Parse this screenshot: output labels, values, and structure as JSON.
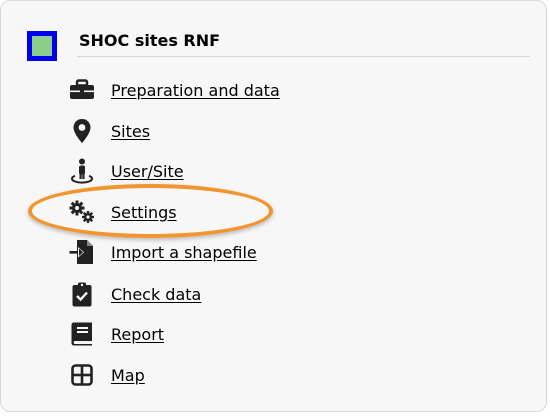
{
  "header": {
    "title": "SHOC sites RNF",
    "logo_colors": {
      "border": "#0000ee",
      "fill": "#8ccf8c"
    }
  },
  "menu": {
    "items": [
      {
        "label": "Preparation and data",
        "icon": "toolbox-icon"
      },
      {
        "label": "Sites",
        "icon": "map-marker-icon"
      },
      {
        "label": "User/Site",
        "icon": "user-location-icon"
      },
      {
        "label": "Settings",
        "icon": "gears-icon"
      },
      {
        "label": "Import a shapefile",
        "icon": "file-import-icon"
      },
      {
        "label": "Check data",
        "icon": "clipboard-check-icon"
      },
      {
        "label": "Report",
        "icon": "book-icon"
      },
      {
        "label": "Map",
        "icon": "grid-map-icon"
      }
    ]
  },
  "annotation": {
    "highlighted_item": "Settings",
    "color": "#f2952f"
  }
}
